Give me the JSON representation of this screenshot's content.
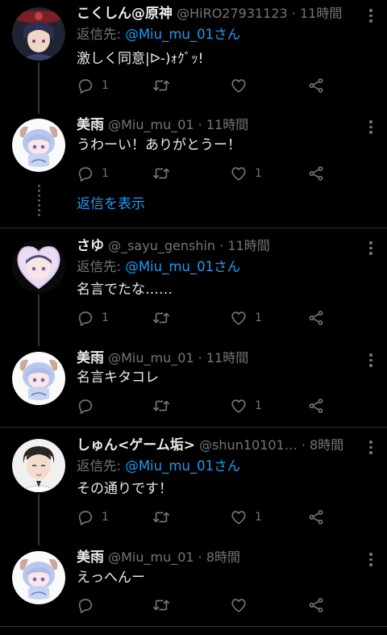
{
  "tweets": [
    {
      "name": "こくしん@原神",
      "handle": "@HiRO27931123",
      "time": "11時間",
      "reply_prefix": "返信先: ",
      "reply_mention": "@Miu_mu_01さん",
      "text": "激しく同意|ᐅ-)ｫｸﾞｯ!",
      "replies": "1",
      "retweets": "",
      "likes": ""
    },
    {
      "name": "美雨",
      "handle": "@Miu_mu_01",
      "time": "11時間",
      "text": "うわーい！ありがとうー！",
      "replies": "1",
      "retweets": "",
      "likes": "1"
    },
    {
      "show_replies": "返信を表示"
    },
    {
      "name": "さゆ",
      "handle": "@_sayu_genshin",
      "time": "11時間",
      "reply_prefix": "返信先: ",
      "reply_mention": "@Miu_mu_01さん",
      "text": "名言でたな……",
      "replies": "1",
      "retweets": "",
      "likes": "1"
    },
    {
      "name": "美雨",
      "handle": "@Miu_mu_01",
      "time": "11時間",
      "text": "名言キタコレ",
      "replies": "",
      "retweets": "",
      "likes": "1"
    },
    {
      "name": "しゅん<ゲーム垢>",
      "handle": "@shun10101…",
      "time": "8時間",
      "reply_prefix": "返信先: ",
      "reply_mention": "@Miu_mu_01さん",
      "text": "その通りです！",
      "replies": "1",
      "retweets": "",
      "likes": "1"
    },
    {
      "name": "美雨",
      "handle": "@Miu_mu_01",
      "time": "8時間",
      "text": "えっへんー",
      "replies": "",
      "retweets": "",
      "likes": ""
    }
  ],
  "separator_dot": "·",
  "icons": {
    "reply": "reply-icon",
    "retweet": "retweet-icon",
    "like": "heart-icon",
    "share": "share-icon",
    "more": "more-icon"
  },
  "colors": {
    "background": "#000000",
    "text": "#e7e9ea",
    "muted": "#71767b",
    "link": "#1d9bf0",
    "divider": "#2f3336"
  }
}
